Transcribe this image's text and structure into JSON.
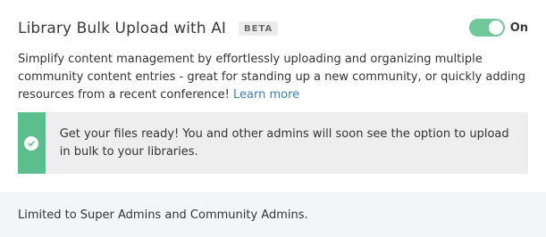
{
  "setting": {
    "title": "Library Bulk Upload with AI",
    "badge": "BETA",
    "toggle_state": "On",
    "description": "Simplify content management by effortlessly uploading and organizing multiple community content entries - great for standing up a new community, or quickly adding resources from a recent conference!",
    "learn_more": "Learn more"
  },
  "notice": {
    "text": "Get your files ready! You and other admins will soon see the option to upload in bulk to your libraries.",
    "icon": "check-circle-icon"
  },
  "footer": {
    "text": "Limited to Super Admins and Community Admins."
  },
  "colors": {
    "toggle_on": "#6fc79a",
    "notice_stripe": "#5cbd8d",
    "link": "#3c7fb5"
  }
}
